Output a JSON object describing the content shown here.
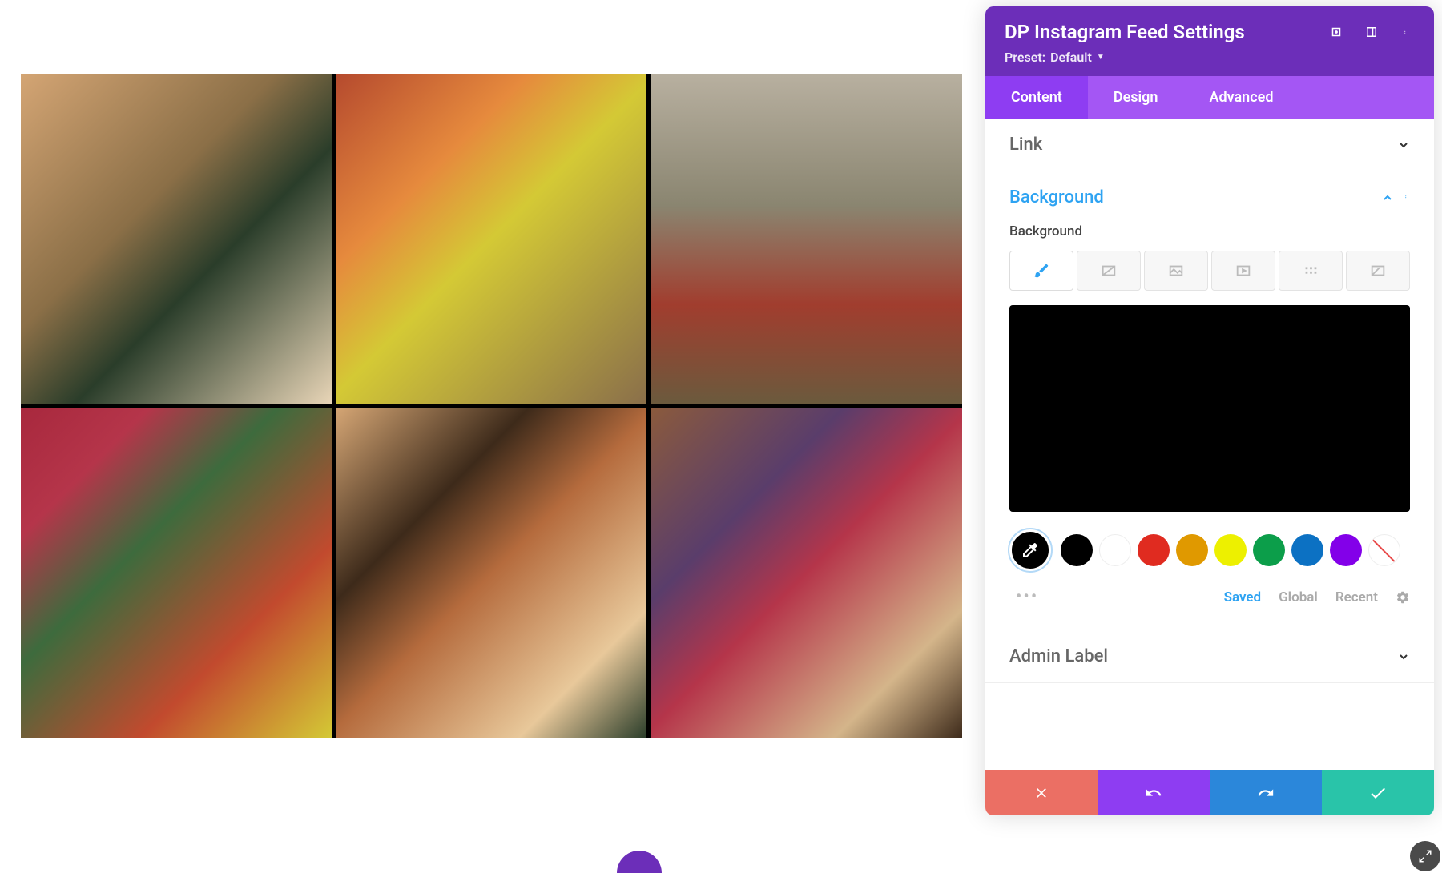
{
  "panel": {
    "title": "DP Instagram Feed Settings",
    "preset_prefix": "Preset:",
    "preset_value": "Default"
  },
  "tabs": {
    "content": "Content",
    "design": "Design",
    "advanced": "Advanced"
  },
  "sections": {
    "link": "Link",
    "background": "Background",
    "admin_label": "Admin Label"
  },
  "background": {
    "label": "Background",
    "preview_color": "#000000",
    "swatches": [
      "#000000",
      "#ffffff",
      "#e02b20",
      "#e09900",
      "#edf000",
      "#0c9e4a",
      "#0c71c3",
      "#8300e9"
    ]
  },
  "color_actions": {
    "saved": "Saved",
    "global": "Global",
    "recent": "Recent"
  }
}
